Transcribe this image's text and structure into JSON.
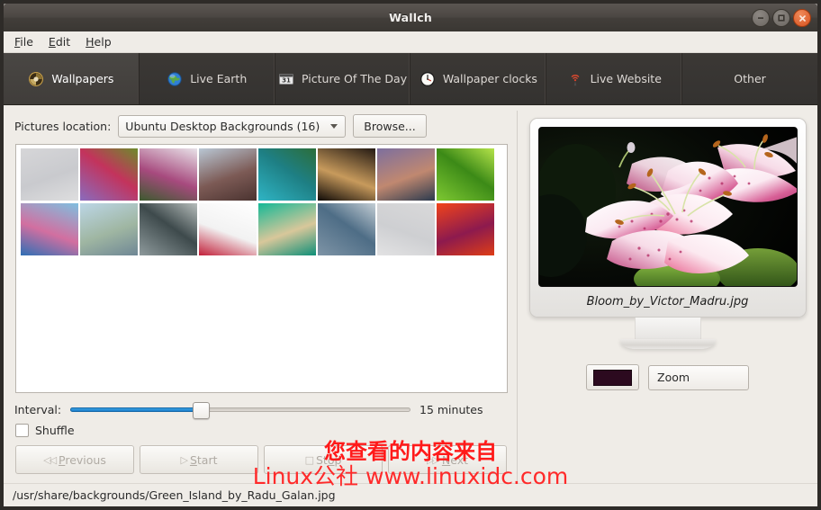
{
  "window": {
    "title": "Wallch",
    "buttons": {
      "minimize": "minimize",
      "maximize": "maximize",
      "close": "close"
    }
  },
  "menubar": [
    {
      "label": "File",
      "accel": "F"
    },
    {
      "label": "Edit",
      "accel": "E"
    },
    {
      "label": "Help",
      "accel": "H"
    }
  ],
  "tabs": [
    {
      "label": "Wallpapers",
      "icon": "wallpaper-icon",
      "active": true
    },
    {
      "label": "Live Earth",
      "icon": "globe-icon",
      "active": false
    },
    {
      "label": "Picture Of The Day",
      "icon": "calendar-icon",
      "active": false
    },
    {
      "label": "Wallpaper clocks",
      "icon": "clock-icon",
      "active": false
    },
    {
      "label": "Live Website",
      "icon": "antenna-icon",
      "active": false
    },
    {
      "label": "Other",
      "icon": "",
      "active": false
    }
  ],
  "location": {
    "label": "Pictures location:",
    "selected": "Ubuntu Desktop Backgrounds (16)",
    "browse_label": "Browse..."
  },
  "thumbnails": [
    {
      "name": "thumb-1",
      "c1": "#d6d6d8",
      "c2": "#c9cace",
      "c3": "#dededf"
    },
    {
      "name": "thumb-2",
      "c1": "#8a6bbd",
      "c2": "#c3335c",
      "c3": "#6d8b2c"
    },
    {
      "name": "thumb-3",
      "c1": "#e8e2e8",
      "c2": "#a74a7e",
      "c3": "#3c5a2e"
    },
    {
      "name": "thumb-4",
      "c1": "#b9c7d4",
      "c2": "#7c5a55",
      "c3": "#4a3330"
    },
    {
      "name": "thumb-5",
      "c1": "#2fb4c4",
      "c2": "#1e7f84",
      "c3": "#2c6e3a"
    },
    {
      "name": "thumb-6",
      "c1": "#241a13",
      "c2": "#c79a5c",
      "c3": "#0f0a07"
    },
    {
      "name": "thumb-7",
      "c1": "#7d6f9e",
      "c2": "#c08870",
      "c3": "#2b3a4e"
    },
    {
      "name": "thumb-8",
      "c1": "#7ec832",
      "c2": "#3c8a17",
      "c3": "#b5e34a"
    },
    {
      "name": "thumb-9",
      "c1": "#7fbfe0",
      "c2": "#d26fa0",
      "c3": "#2f6fb5"
    },
    {
      "name": "thumb-10",
      "c1": "#bcd6e6",
      "c2": "#9fb6a2",
      "c3": "#6f8795"
    },
    {
      "name": "thumb-11",
      "c1": "#8e9a9c",
      "c2": "#3e4a4c",
      "c3": "#b6bdbb"
    },
    {
      "name": "thumb-12",
      "c1": "#ffffff",
      "c2": "#f2f2f2",
      "c3": "#c2203a"
    },
    {
      "name": "thumb-13",
      "c1": "#14b896",
      "c2": "#d8c79a",
      "c3": "#0e8f78"
    },
    {
      "name": "thumb-14",
      "c1": "#7e94a6",
      "c2": "#4e6d86",
      "c3": "#c3cdd4"
    },
    {
      "name": "thumb-15",
      "c1": "#d9d9da",
      "c2": "#cecfd2",
      "c3": "#e2e2e3"
    },
    {
      "name": "thumb-16",
      "c1": "#f1441a",
      "c2": "#8d1a4e",
      "c3": "#de3d16"
    }
  ],
  "interval": {
    "label": "Interval:",
    "value_text": "15 minutes",
    "percent": 38
  },
  "shuffle": {
    "label": "Shuffle",
    "checked": false
  },
  "transport": [
    {
      "name": "previous-button",
      "glyph": "◁◁",
      "label": "Previous",
      "accel": "P",
      "enabled": false
    },
    {
      "name": "start-button",
      "glyph": "▷",
      "label": "Start",
      "accel": "S",
      "enabled": false
    },
    {
      "name": "stop-button",
      "glyph": "□",
      "label": "Stop",
      "accel": "o",
      "enabled": false
    },
    {
      "name": "next-button",
      "glyph": "▷▷",
      "label": "Next",
      "accel": "N",
      "enabled": false
    }
  ],
  "preview": {
    "filename": "Bloom_by_Victor_Madru.jpg"
  },
  "style": {
    "color_hex": "#2c0a1f",
    "zoom_label": "Zoom"
  },
  "statusbar": {
    "path": "/usr/share/backgrounds/Green_Island_by_Radu_Galan.jpg"
  },
  "watermark": {
    "line1": "您查看的内容来自",
    "line2": "Linux公社 www.linuxidc.com",
    "color": "#ff2020"
  }
}
